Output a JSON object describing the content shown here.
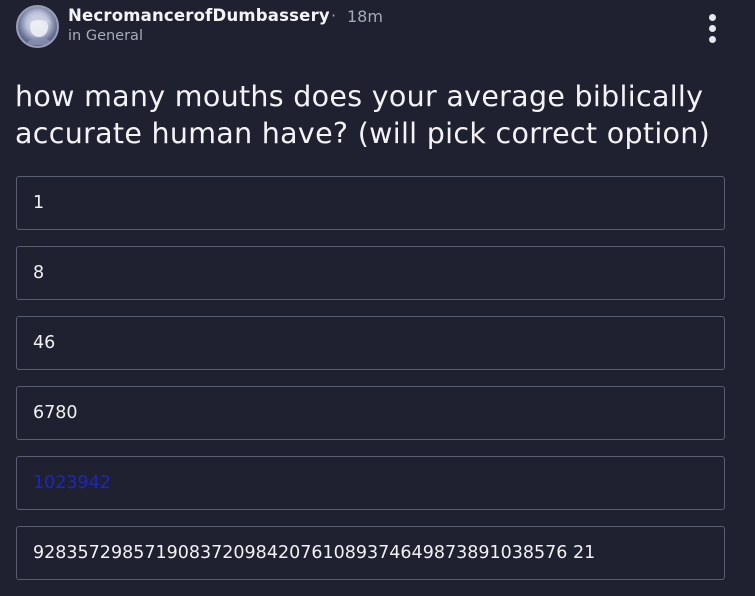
{
  "post": {
    "author": "NecromancerofDumbassery",
    "separator": "·",
    "timestamp": "18m",
    "location": "in General",
    "question": "how many mouths does your average biblically accurate human have? (will pick correct option)"
  },
  "poll": {
    "options": [
      {
        "label": "1"
      },
      {
        "label": "8"
      },
      {
        "label": "46"
      },
      {
        "label": "6780"
      },
      {
        "label": "1023942",
        "color": "#1d27b8"
      },
      {
        "label": "928357298571908372098420761089374649873891038576 21"
      }
    ]
  },
  "icons": {
    "avatar": "avatar-image",
    "more": "more-vertical-icon"
  },
  "colors": {
    "background": "#1f2130",
    "border": "#5b5e70",
    "highlight_text": "#1d27b8"
  }
}
